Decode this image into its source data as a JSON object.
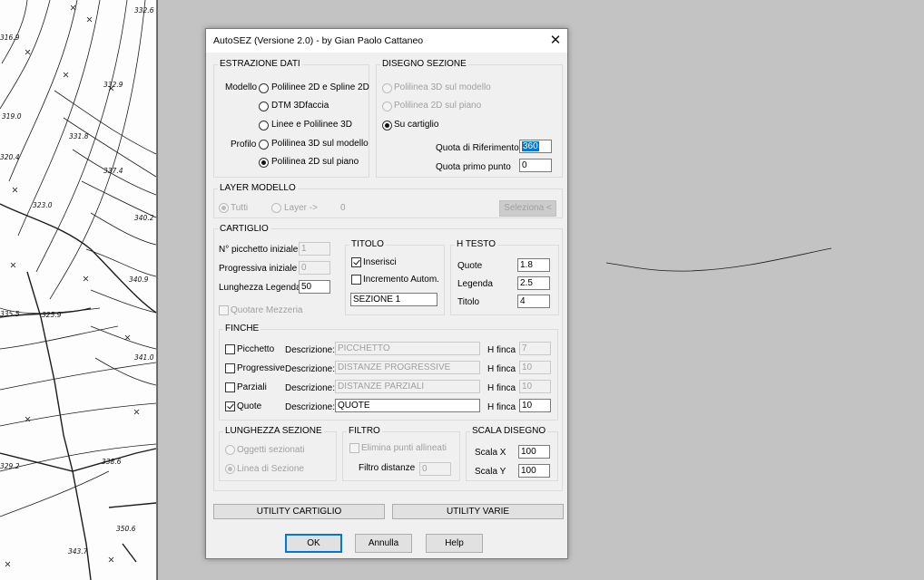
{
  "background": {
    "elevations": [
      "332.6",
      "316.9",
      "332.9",
      "319.0",
      "331.8",
      "320.4",
      "337.4",
      "323.0",
      "340.2",
      "340.9",
      "325.9",
      "335.5",
      "341.0",
      "338.6",
      "329.2",
      "350.6",
      "343.7"
    ]
  },
  "dialog": {
    "title": "AutoSEZ (Versione 2.0) - by Gian Paolo Cattaneo",
    "close_glyph": "✕",
    "estrazione": {
      "title": "ESTRAZIONE DATI",
      "modello_label": "Modello",
      "profilo_label": "Profilo",
      "opt_polilinee_spline": "Polilinee 2D e Spline 2D",
      "opt_dtm": "DTM 3Dfaccia",
      "opt_linee": "Linee e Polilinee 3D",
      "opt_prof_3d": "Polilinea 3D sul modello",
      "opt_prof_2d": "Polilinea 2D sul piano"
    },
    "disegno": {
      "title": "DISEGNO SEZIONE",
      "opt_3d": "Polilinea 3D sul modello",
      "opt_2d": "Polilinea 2D sul piano",
      "opt_cartiglio": "Su cartiglio",
      "quota_rif_label": "Quota di Riferimento",
      "quota_rif_value": "360",
      "quota_primo_label": "Quota primo punto",
      "quota_primo_value": "0"
    },
    "layer": {
      "title": "LAYER MODELLO",
      "tutti": "Tutti",
      "layer": "Layer ->",
      "count": "0",
      "seleziona": "Seleziona <"
    },
    "cartiglio": {
      "title": "CARTIGLIO",
      "picchetto_label": "N° picchetto iniziale",
      "picchetto_value": "1",
      "progressiva_label": "Progressiva iniziale",
      "progressiva_value": "0",
      "lunghezza_label": "Lunghezza Legenda",
      "lunghezza_value": "50",
      "quotare_mezzeria": "Quotare Mezzeria",
      "titolo": {
        "title": "TITOLO",
        "inserisci": "Inserisci",
        "incremento": "Incremento Autom.",
        "value": "SEZIONE 1"
      },
      "htesto": {
        "title": "H TESTO",
        "quote_label": "Quote",
        "quote_value": "1.8",
        "legenda_label": "Legenda",
        "legenda_value": "2.5",
        "titolo_label": "Titolo",
        "titolo_value": "4"
      },
      "finche": {
        "title": "FINCHE",
        "desc_label": "Descrizione:",
        "hfinca_label": "H finca",
        "rows": [
          {
            "label": "Picchetto",
            "desc": "PICCHETTO",
            "h": "7"
          },
          {
            "label": "Progressive",
            "desc": "DISTANZE PROGRESSIVE",
            "h": "10"
          },
          {
            "label": "Parziali",
            "desc": "DISTANZE PARZIALI",
            "h": "10"
          },
          {
            "label": "Quote",
            "desc": "QUOTE",
            "h": "10"
          }
        ]
      },
      "lunghezza_sezione": {
        "title": "LUNGHEZZA SEZIONE",
        "oggetti": "Oggetti sezionati",
        "linea": "Linea di Sezione"
      },
      "filtro": {
        "title": "FILTRO",
        "elimina": "Elimina punti allineati",
        "distanze_label": "Filtro distanze",
        "distanze_value": "0"
      },
      "scala": {
        "title": "SCALA DISEGNO",
        "x_label": "Scala  X",
        "x_value": "100",
        "y_label": "Scala  Y",
        "y_value": "100"
      }
    },
    "utility_cartiglio": "UTILITY CARTIGLIO",
    "utility_varie": "UTILITY VARIE",
    "ok": "OK",
    "annulla": "Annulla",
    "help": "Help"
  }
}
